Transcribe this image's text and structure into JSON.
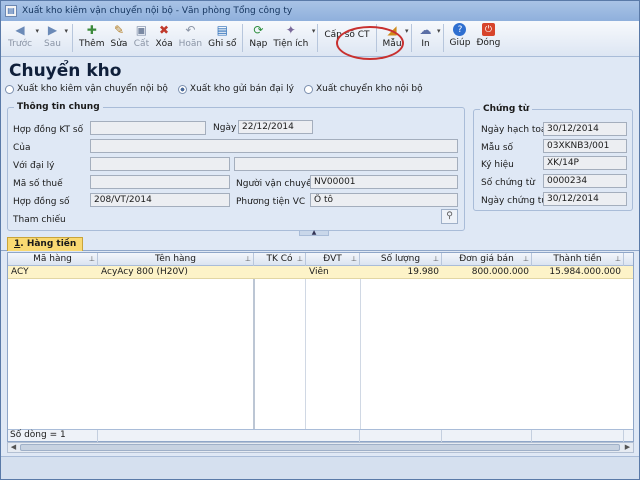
{
  "window": {
    "title": "Xuất kho kiêm vận chuyển nội bộ - Văn phòng Tổng công ty"
  },
  "toolbar": {
    "prev": "Trước",
    "next": "Sau",
    "add": "Thêm",
    "edit": "Sửa",
    "save": "Cất",
    "delete": "Xóa",
    "undo": "Hoãn",
    "post": "Ghi sổ",
    "load": "Nạp",
    "utility": "Tiện ích",
    "assign_no": "Cấp số CT",
    "template": "Mẫu",
    "print": "In",
    "help": "Giúp",
    "close": "Đóng"
  },
  "page": {
    "heading": "Chuyển kho"
  },
  "radios": [
    {
      "label": "Xuất kho kiêm vận chuyển nội bộ",
      "checked": false
    },
    {
      "label": "Xuất kho gửi bán đại lý",
      "checked": true
    },
    {
      "label": "Xuất chuyển kho nội bộ",
      "checked": false
    }
  ],
  "general": {
    "title": "Thông tin chung",
    "contract_label": "Hợp đồng KT số",
    "contract_value": "",
    "date_label": "Ngày",
    "date_value": "22/12/2014",
    "of_label": "Của",
    "of_value": "",
    "agent_label": "Với đại lý",
    "agent_value": "",
    "agent_value2": "",
    "tax_label": "Mã số thuế",
    "tax_value": "",
    "carrier_label": "Người vận chuyển",
    "carrier_value": "NV00001",
    "contract_no_label": "Hợp đồng số",
    "contract_no_value": "208/VT/2014",
    "vehicle_label": "Phương tiện VC",
    "vehicle_value": "Ô tô",
    "ref_label": "Tham chiếu"
  },
  "voucher": {
    "title": "Chứng từ",
    "account_date_label": "Ngày hạch toán",
    "account_date_value": "30/12/2014",
    "form_label": "Mẫu số",
    "form_value": "03XKNB3/001",
    "symbol_label": "Ký hiệu",
    "symbol_value": "XK/14P",
    "number_label": "Số chứng từ",
    "number_value": "0000234",
    "voucher_date_label": "Ngày chứng từ",
    "voucher_date_value": "30/12/2014"
  },
  "tab": {
    "number": "1",
    "label": "Hàng tiền"
  },
  "grid": {
    "headers": [
      "Mã hàng",
      "Tên hàng",
      "TK Có",
      "ĐVT",
      "Số lượng",
      "Đơn giá bán",
      "Thành tiền"
    ],
    "rows": [
      [
        "ACY",
        "AcyAcy 800 (H20V)",
        "",
        "Viên",
        "19.980",
        "800.000.000",
        "15.984.000.000"
      ]
    ],
    "footer": "Số dòng = 1"
  }
}
